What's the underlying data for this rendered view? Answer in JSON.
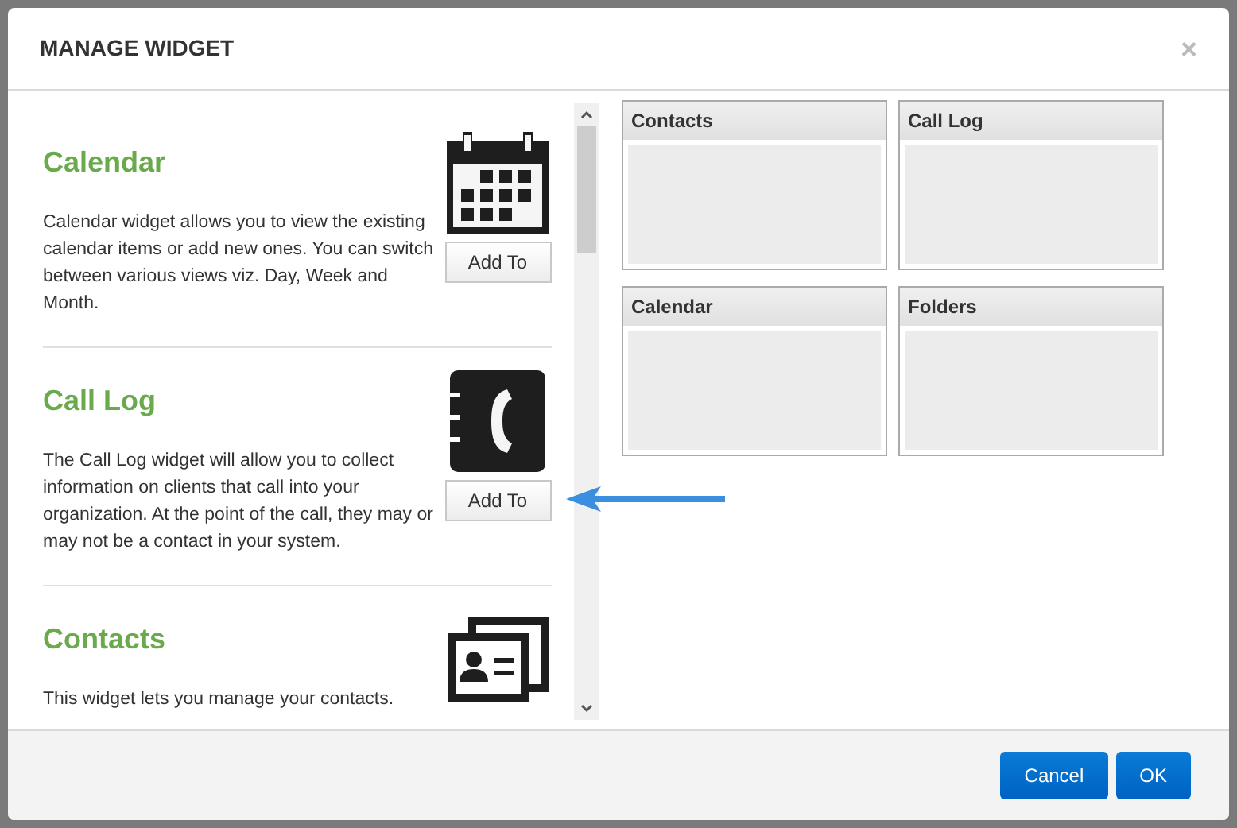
{
  "dialog": {
    "title": "MANAGE WIDGET",
    "close": "×"
  },
  "widgets": [
    {
      "kind": "calendar",
      "title": "Calendar",
      "description": "Calendar widget allows you to view the existing calendar items or add new ones. You can switch between various views viz. Day, Week and Month.",
      "button": "Add To"
    },
    {
      "kind": "phone",
      "title": "Call Log",
      "description": "The Call Log widget will allow you to collect information on clients that call into your organization. At the point of the call, they may or may not be a contact in your system.",
      "button": "Add To"
    },
    {
      "kind": "contacts",
      "title": "Contacts",
      "description": "This widget lets you manage your contacts."
    }
  ],
  "layout_cards": [
    {
      "title": "Contacts"
    },
    {
      "title": "Call Log"
    },
    {
      "title": "Calendar"
    },
    {
      "title": "Folders"
    }
  ],
  "buttons": [
    {
      "label": "Cancel"
    },
    {
      "label": "OK"
    }
  ]
}
